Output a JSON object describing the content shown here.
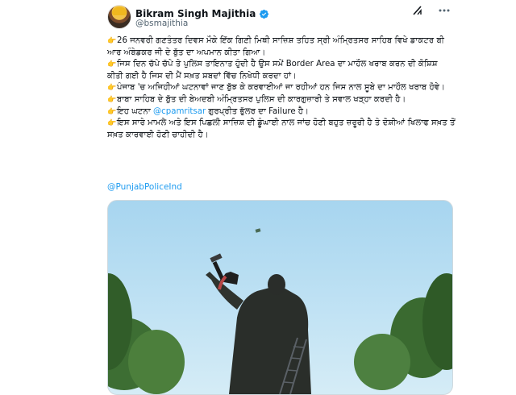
{
  "author": {
    "display_name": "Bikram Singh Majithia",
    "handle": "@bsmajithia",
    "verified": true
  },
  "icons": {
    "grok": "grok-icon",
    "more": "more-options-icon",
    "verified": "verified-badge-icon",
    "bullet": "pointing-finger-icon"
  },
  "tweet": {
    "line1": "26 ਜਨਵਰੀ ਗਣਤੰਤਰ ਦਿਵਸ ਮੌਕੇ ਇੱਕ ਗਿਣੀ ਮਿਥੀ ਸਾਜ਼ਿਸ਼ ਤਹਿਤ ਸ੍ਰੀ ਅੰਮ੍ਰਿਤਸਰ ਸਾਹਿਬ ਵਿਖੇ ਡਾਕਟਰ ਬੀ ਆਰ ਅੰਬੇਡਕਰ ਜੀ ਦੇ ਬੁੱਤ ਦਾ ਅਪਮਾਨ ਕੀਤਾ ਗਿਆ।",
    "line2": "ਜਿਸ ਦਿਨ ਚੱਪੇ ਚੱਪੇ ਤੇ ਪੁਲਿਸ ਤਾਇਨਾਤ ਹੁੰਦੀ ਹੈ ਉਸ ਸਮੇਂ Border Area ਦਾ ਮਾਹੌਲ ਖਰਾਬ ਕਰਨ ਦੀ ਕੋਸ਼ਿਸ਼ ਕੀਤੀ ਗਈ ਹੈ ਜਿਸ ਦੀ ਮੈਂ ਸਖ਼ਤ ਸ਼ਬਦਾਂ ਵਿੱਚ ਨਿਖੇਧੀ ਕਰਦਾ ਹਾਂ।",
    "line3": "ਪੰਜਾਬ 'ਚ ਅਜਿਹੀਆਂ ਘਟਨਾਵਾਂ ਜਾਣ ਬੁੱਝ ਕੇ ਕਰਵਾਈਆਂ ਜਾ ਰਹੀਆਂ ਹਨ ਜਿਸ ਨਾਲ ਸੂਬੇ ਦਾ ਮਾਹੌਲ ਖਰਾਬ ਹੋਵੇ।",
    "line4": "ਬਾਬਾ ਸਾਹਿਬ ਦੇ ਬੁੱਤ ਦੀ ਬੇਅਦਬੀ ਅੰਮ੍ਰਿਤਸਰ ਪੁਲਿਸ ਦੀ ਕਾਰਗੁਜ਼ਾਰੀ ਤੇ ਸਵਾਲ ਖੜ੍ਹਾ ਕਰਦੀ ਹੈ।",
    "line5_prefix": "ਇਹ ਘਟਨਾ ",
    "line5_mention": "@cpamritsar",
    "line5_suffix": " ਗੁਰਪ੍ਰੀਤ ਭੁੱਲਰ ਦਾ Failure ਹੈ।",
    "line6": "ਇਸ ਸਾਰੇ ਮਾਮਲੇ ਅਤੇ ਇਸ ਪਿਛਲੀ ਸਾਜ਼ਿਸ਼ ਦੀ ਡੂੰਘਾਈ ਨਾਲ ਜਾਂਚ ਹੋਣੀ ਬਹੁਤ ਜ਼ਰੂਰੀ ਹੈ ਤੇ ਦੋਸ਼ੀਆਂ ਖਿਲਾਫ ਸਖ਼ਤ ਤੋਂ ਸਖ਼ਤ ਕਾਰਵਾਈ ਹੋਣੀ ਚਾਹੀਦੀ ਹੈ।",
    "mention_tag": "@PunjabPoliceInd"
  },
  "colors": {
    "link": "#1d9bf0",
    "verified": "#1d9bf0",
    "text": "#0f1419",
    "secondary": "#536471"
  },
  "media": {
    "type": "photo",
    "subject": "statue-under-blue-sky"
  }
}
